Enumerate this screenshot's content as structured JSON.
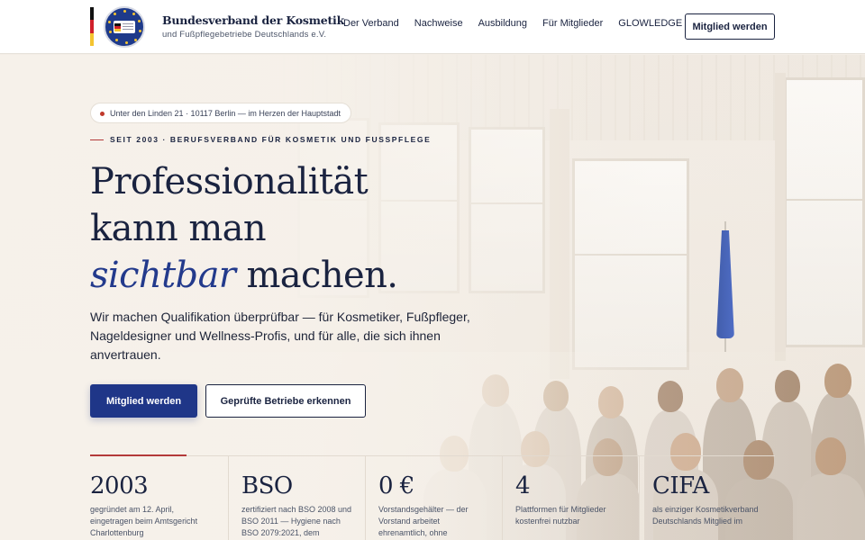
{
  "header": {
    "brand_title": "Bundesverband der Kosmetik",
    "brand_subtitle": "und Fußpflegebetriebe Deutschlands e.V.",
    "nav": [
      "Der Verband",
      "Nachweise",
      "Ausbildung",
      "Für Mitglieder",
      "GLOWLEDGE"
    ],
    "cta_label": "Mitglied werden"
  },
  "hero": {
    "address": "Unter den Linden 21 · 10117 Berlin — im Herzen der Hauptstadt",
    "eyebrow": "SEIT 2003 · BERUFSVERBAND FÜR KOSMETIK UND FUSSPFLEGE",
    "headline_line1": "Professionalität",
    "headline_line2": "kann man",
    "headline_em": "sichtbar",
    "headline_line3_rest": " machen.",
    "lead": "Wir machen Qualifikation überprüfbar — für Kosmetiker, Fußpfleger, Nageldesigner und Wellness-Profis, und für alle, die sich ihnen anvertrauen.",
    "primary_button": "Mitglied werden",
    "secondary_button": "Geprüfte Betriebe erkennen"
  },
  "stats": [
    {
      "value": "2003",
      "desc": "gegründet am 12. April, eingetragen beim Amtsgericht Charlottenburg"
    },
    {
      "value": "BSO",
      "desc": "zertifiziert nach BSO 2008 und BSO 2011 — Hygiene nach BSO 2079:2021, dem"
    },
    {
      "value": "0 €",
      "desc": "Vorstandsgehälter — der Vorstand arbeitet ehrenamtlich, ohne"
    },
    {
      "value": "4",
      "desc": "Plattformen für Mitglieder kostenfrei nutzbar"
    },
    {
      "value": "CIFA",
      "desc": "als einziger Kosmetikverband Deutschlands Mitglied im"
    }
  ],
  "colors": {
    "navy": "#1a2340",
    "primary_button": "#1f3688",
    "accent_red": "#b33a3a",
    "hero_bg": "#f2ece5"
  }
}
